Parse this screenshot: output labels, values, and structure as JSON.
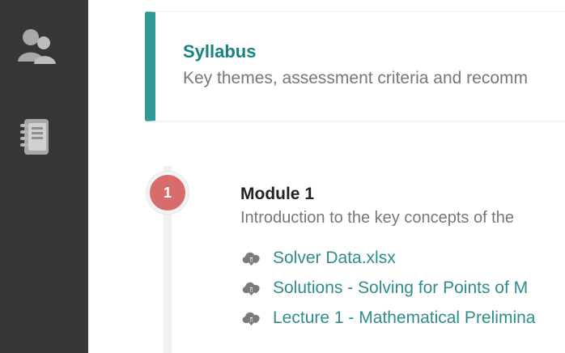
{
  "sidebar": {
    "items": [
      {
        "icon": "users-icon"
      },
      {
        "icon": "notebook-icon"
      }
    ]
  },
  "syllabus": {
    "title": "Syllabus",
    "description": "Key themes, assessment criteria and recomm"
  },
  "modules": [
    {
      "number": "1",
      "title": "Module 1",
      "description": "Introduction to the key concepts of the",
      "resources": [
        {
          "label": "Solver Data.xlsx",
          "icon": "cloud-download-icon"
        },
        {
          "label": "Solutions - Solving for Points of M",
          "icon": "cloud-download-icon"
        },
        {
          "label": "Lecture 1 - Mathematical Prelimina",
          "icon": "cloud-download-icon"
        }
      ]
    }
  ],
  "colors": {
    "sidebar_bg": "#363636",
    "accent": "#2f9a96",
    "link": "#2e8d8a",
    "badge": "#d86b6b"
  }
}
